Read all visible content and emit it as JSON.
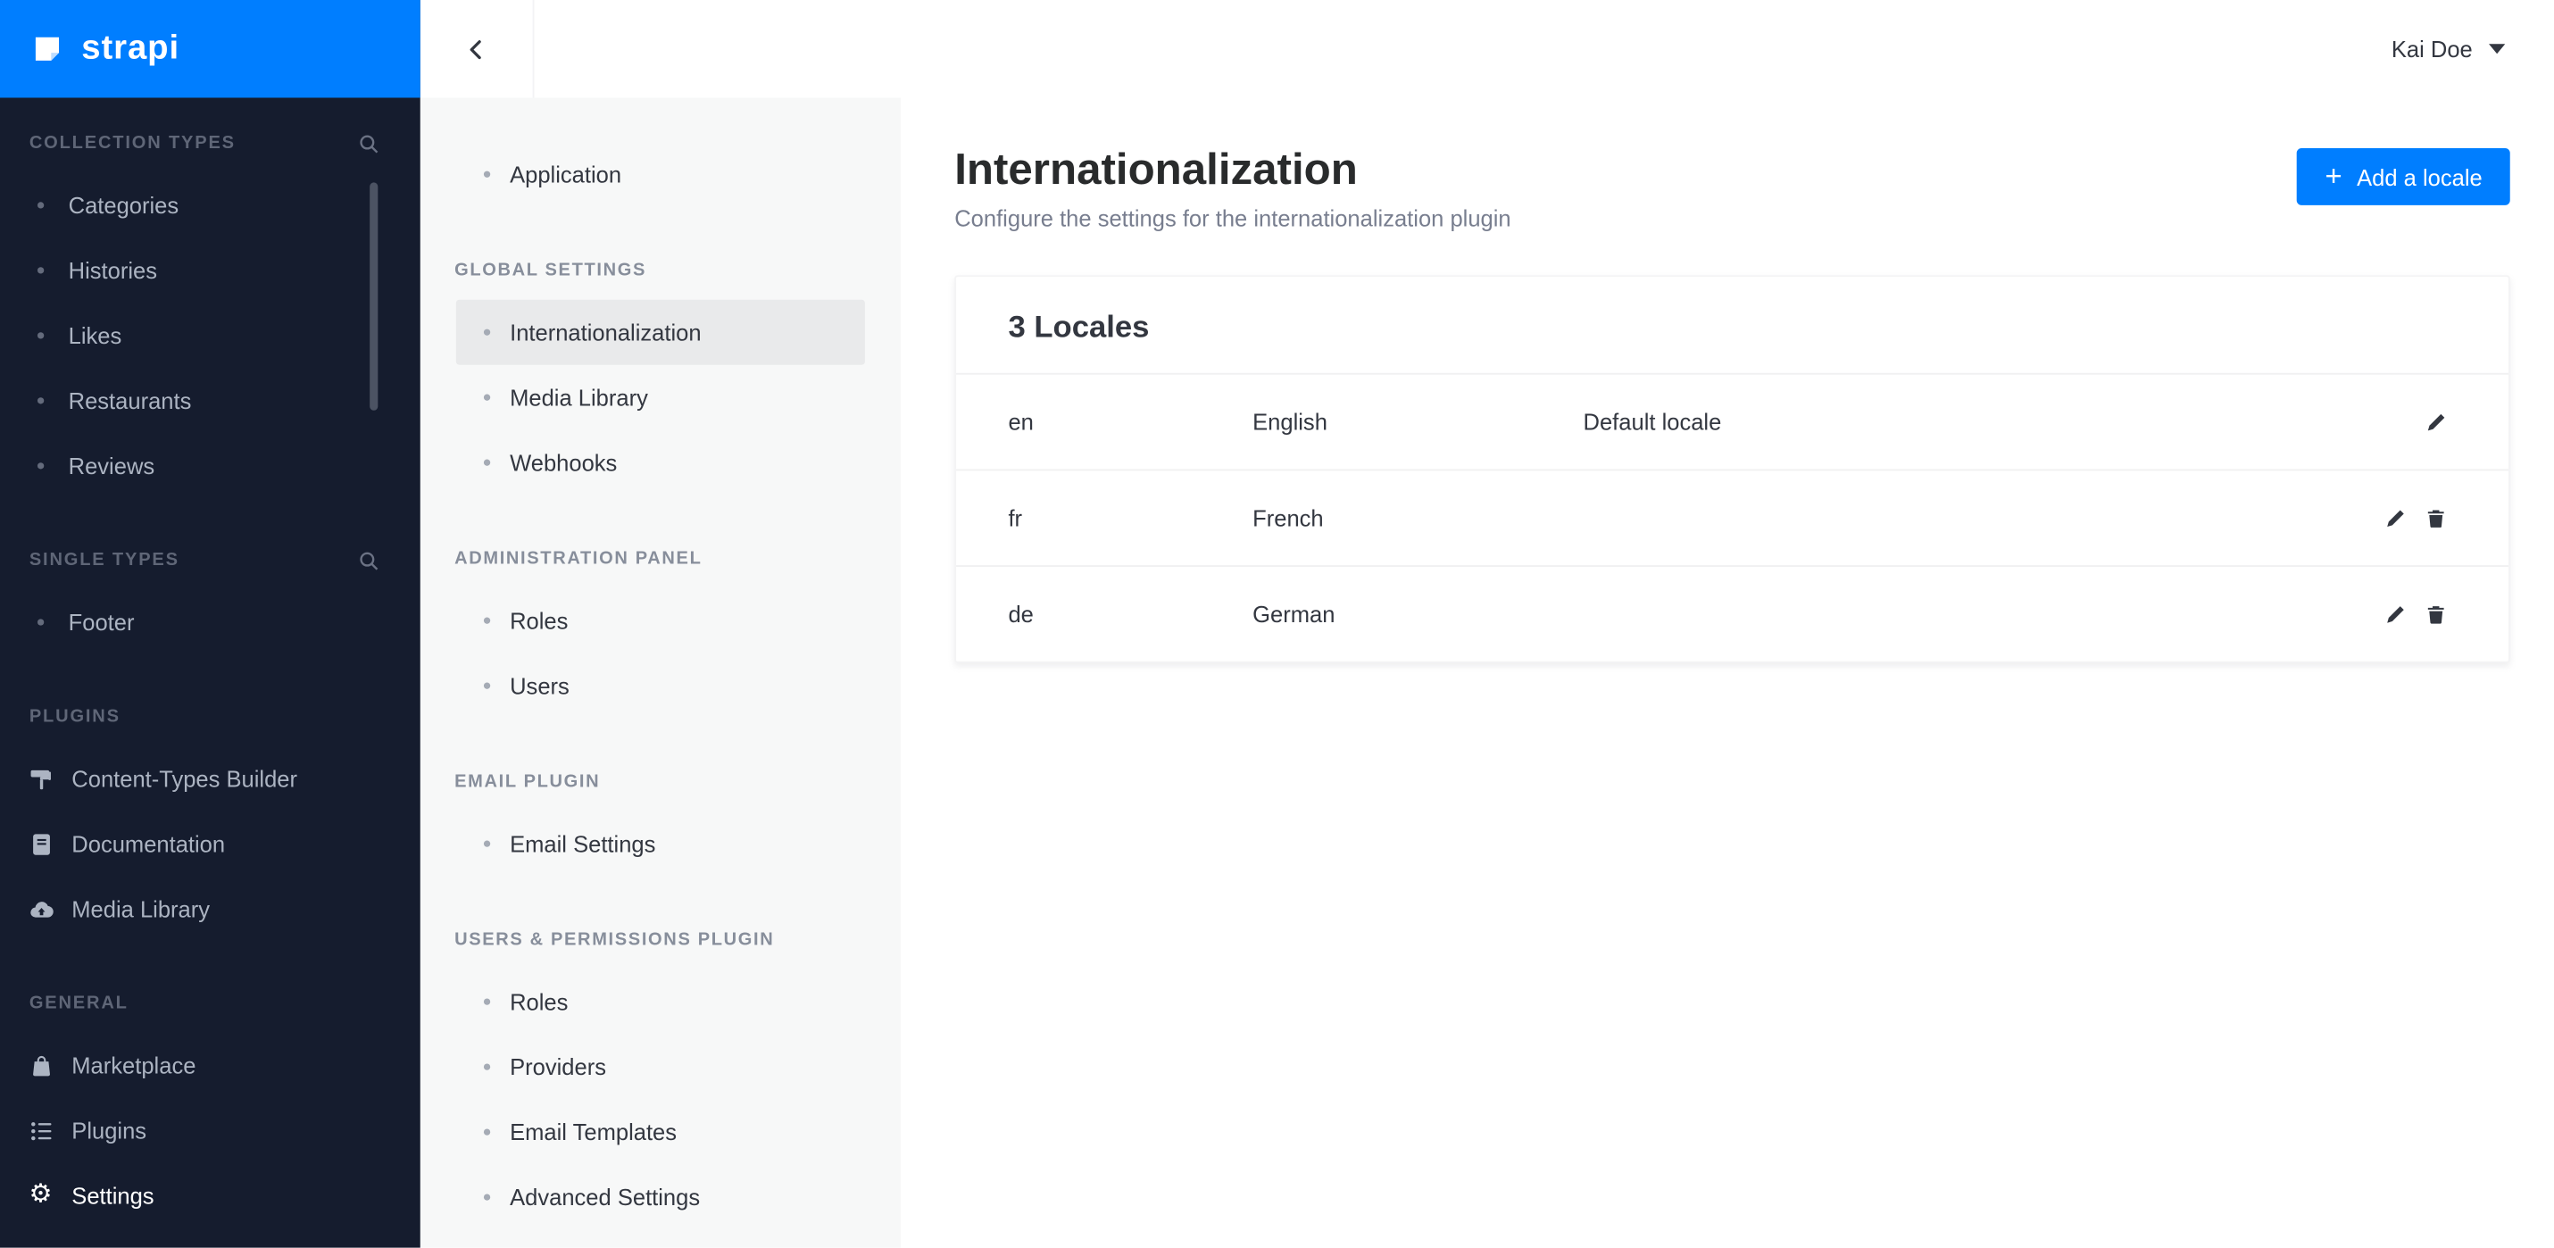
{
  "brand": {
    "name": "strapi",
    "accent_color": "#007eff",
    "sidebar_color": "#151c2e"
  },
  "topbar": {
    "back_icon": "chevron-left",
    "user": {
      "name": "Kai Doe"
    }
  },
  "sidebar": {
    "sections": [
      {
        "title": "COLLECTION TYPES",
        "search": true,
        "items": [
          {
            "label": "Categories"
          },
          {
            "label": "Histories"
          },
          {
            "label": "Likes"
          },
          {
            "label": "Restaurants"
          },
          {
            "label": "Reviews"
          }
        ]
      },
      {
        "title": "SINGLE TYPES",
        "search": true,
        "items": [
          {
            "label": "Footer"
          }
        ]
      },
      {
        "title": "PLUGINS",
        "items": [
          {
            "label": "Content-Types Builder",
            "icon": "roller-icon"
          },
          {
            "label": "Documentation",
            "icon": "book-icon"
          },
          {
            "label": "Media Library",
            "icon": "cloud-icon"
          }
        ]
      },
      {
        "title": "GENERAL",
        "items": [
          {
            "label": "Marketplace",
            "icon": "bag-icon"
          },
          {
            "label": "Plugins",
            "icon": "list-icon"
          },
          {
            "label": "Settings",
            "icon": "gear-icon",
            "active": true
          }
        ]
      }
    ]
  },
  "settings_nav": {
    "standalone": [
      {
        "label": "Application"
      }
    ],
    "sections": [
      {
        "title": "GLOBAL SETTINGS",
        "items": [
          {
            "label": "Internationalization",
            "active": true
          },
          {
            "label": "Media Library"
          },
          {
            "label": "Webhooks"
          }
        ]
      },
      {
        "title": "ADMINISTRATION PANEL",
        "items": [
          {
            "label": "Roles"
          },
          {
            "label": "Users"
          }
        ]
      },
      {
        "title": "EMAIL PLUGIN",
        "items": [
          {
            "label": "Email Settings"
          }
        ]
      },
      {
        "title": "USERS & PERMISSIONS PLUGIN",
        "items": [
          {
            "label": "Roles"
          },
          {
            "label": "Providers"
          },
          {
            "label": "Email Templates"
          },
          {
            "label": "Advanced Settings"
          }
        ]
      }
    ]
  },
  "main": {
    "title": "Internationalization",
    "subtitle": "Configure the settings for the internationalization plugin",
    "add_locale_button": "Add a locale",
    "locales_card": {
      "title": "3 Locales",
      "rows": [
        {
          "code": "en",
          "name": "English",
          "note": "Default locale"
        },
        {
          "code": "fr",
          "name": "French",
          "note": ""
        },
        {
          "code": "de",
          "name": "German",
          "note": ""
        }
      ]
    }
  },
  "colors": {
    "accent": "#007eff",
    "sidebar_bg": "#151c2e",
    "subnav_bg": "#f7f8f8",
    "text_dark": "#333740",
    "text_gray": "#787e8f"
  }
}
